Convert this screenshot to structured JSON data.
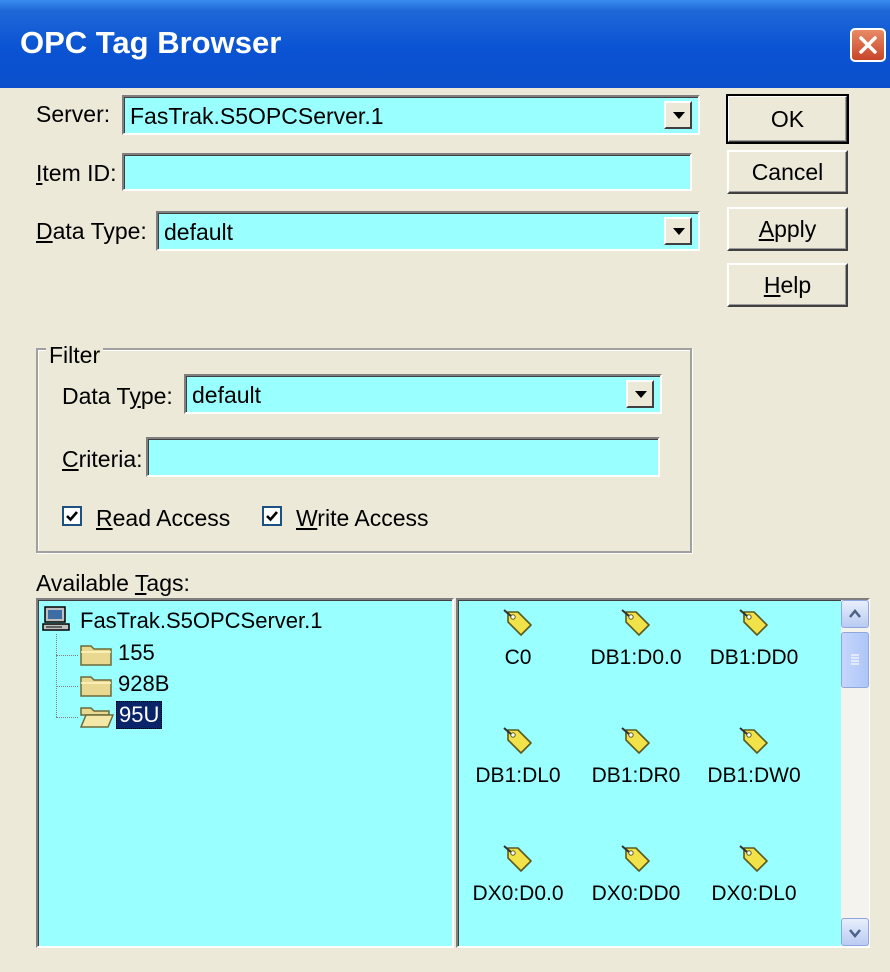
{
  "window": {
    "title": "OPC Tag Browser"
  },
  "server": {
    "label": "Server:",
    "value": "FasTrak.S5OPCServer.1"
  },
  "item_id": {
    "label_accel": "I",
    "label_rest": "tem ID:",
    "value": ""
  },
  "data_type": {
    "label_accel": "D",
    "label_rest": "ata Type:",
    "value": "default"
  },
  "buttons": {
    "ok": "OK",
    "cancel": "Cancel",
    "apply_accel": "A",
    "apply_rest": "pply",
    "help_accel": "H",
    "help_rest": "elp"
  },
  "filter": {
    "legend": "Filter",
    "data_type_pre": "Data T",
    "data_type_accel": "y",
    "data_type_post": "pe:",
    "data_type_value": "default",
    "criteria_accel": "C",
    "criteria_rest": "riteria:",
    "criteria_value": "",
    "read_accel": "R",
    "read_rest": "ead Access",
    "read_checked": true,
    "write_accel": "W",
    "write_rest": "rite Access",
    "write_checked": true
  },
  "available_tags": {
    "label_pre": "Available ",
    "label_accel": "T",
    "label_post": "ags:",
    "tree": {
      "root": "FasTrak.S5OPCServer.1",
      "children": [
        "155",
        "928B",
        "95U"
      ],
      "selected": "95U"
    },
    "tags": [
      "C0",
      "DB1:D0.0",
      "DB1:DD0",
      "DB1:DL0",
      "DB1:DR0",
      "DB1:DW0",
      "DX0:D0.0",
      "DX0:DD0",
      "DX0:DL0"
    ]
  },
  "colors": {
    "field_bg": "#99ffff",
    "title_bar": "#0a53d3",
    "selection": "#0a246a"
  },
  "icons": [
    "close-icon",
    "dropdown-arrow-icon",
    "computer-icon",
    "folder-icon",
    "open-folder-icon",
    "tag-icon",
    "checkmark-icon",
    "scroll-up-icon",
    "scroll-down-icon"
  ]
}
